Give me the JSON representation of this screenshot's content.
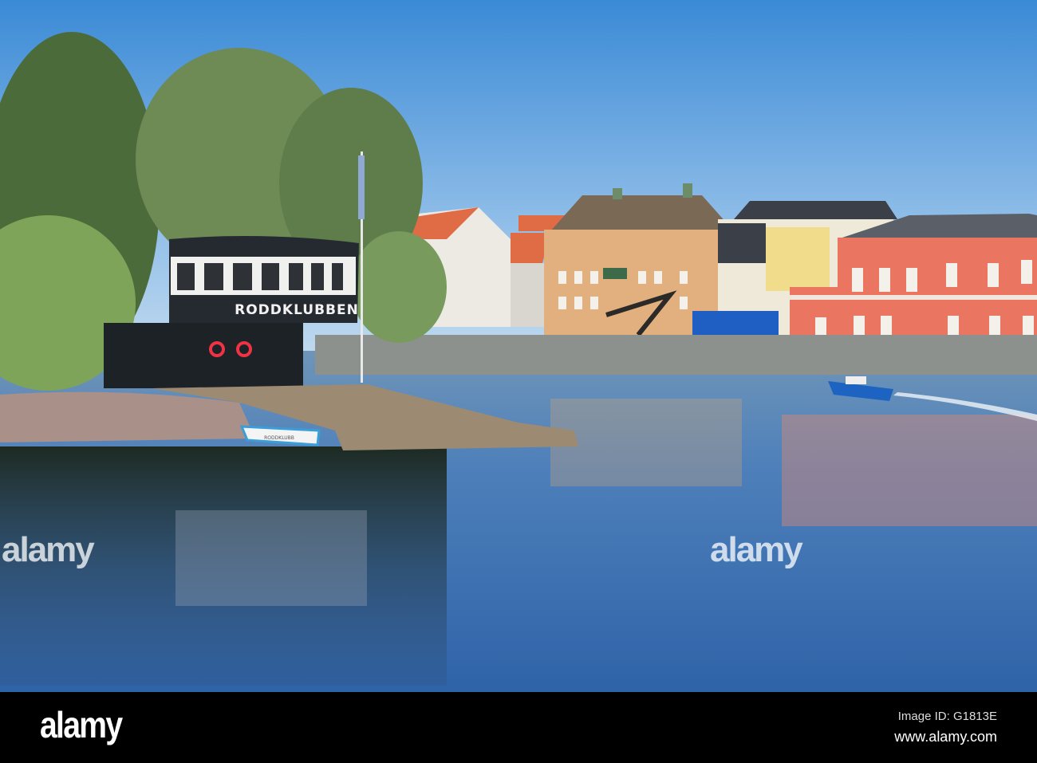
{
  "photo": {
    "sign_text": "RODDKLUBBEN",
    "boat_text": "RODDKLUBB"
  },
  "watermark": {
    "text": "alamy"
  },
  "footer": {
    "logo": "alamy",
    "image_id": "Image ID: G1813E",
    "website": "www.alamy.com"
  }
}
